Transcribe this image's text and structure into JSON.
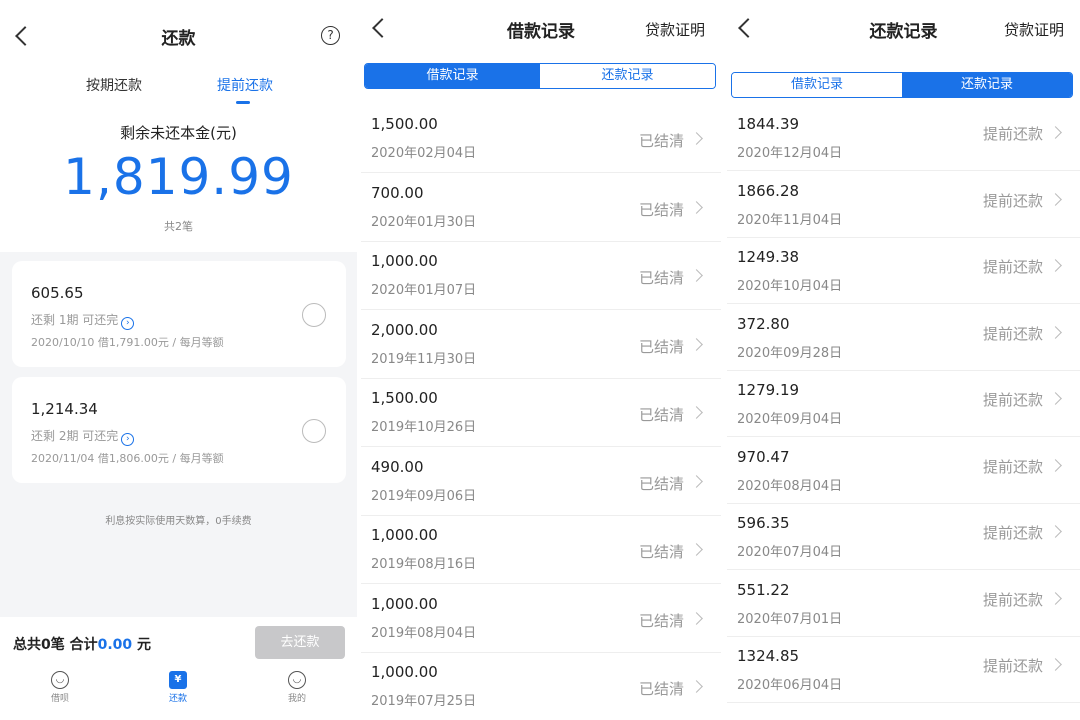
{
  "repay": {
    "title": "还款",
    "help_symbol": "?",
    "tabs": [
      "按期还款",
      "提前还款"
    ],
    "summary": {
      "label": "剩余未还本金(元)",
      "amount": "1,819.99",
      "count": "共2笔"
    },
    "bills": [
      {
        "amount": "605.65",
        "remain": "还剩 1期 可还完",
        "detail": "2020/10/10 借1,791.00元 / 每月等额"
      },
      {
        "amount": "1,214.34",
        "remain": "还剩 2期 可还完",
        "detail": "2020/11/04 借1,806.00元 / 每月等额"
      }
    ],
    "note": "利息按实际使用天数算，0手续费",
    "footer": {
      "total_prefix": "总共0笔 合计",
      "total_amount": "0.00",
      "total_suffix": " 元",
      "pay_button": "去还款"
    },
    "nav": [
      {
        "label": "借呗",
        "icon": "smile-face-icon",
        "glyph": "◡"
      },
      {
        "label": "还款",
        "icon": "yuan-icon",
        "glyph": "¥"
      },
      {
        "label": "我的",
        "icon": "profile-icon",
        "glyph": "◡"
      }
    ]
  },
  "loan_records": {
    "title": "借款记录",
    "certificate_link": "贷款证明",
    "segments": [
      "借款记录",
      "还款记录"
    ],
    "active_segment": 0,
    "rows": [
      {
        "amount": "1,500.00",
        "date": "2020年02月04日",
        "status": "已结清"
      },
      {
        "amount": "700.00",
        "date": "2020年01月30日",
        "status": "已结清"
      },
      {
        "amount": "1,000.00",
        "date": "2020年01月07日",
        "status": "已结清"
      },
      {
        "amount": "2,000.00",
        "date": "2019年11月30日",
        "status": "已结清"
      },
      {
        "amount": "1,500.00",
        "date": "2019年10月26日",
        "status": "已结清"
      },
      {
        "amount": "490.00",
        "date": "2019年09月06日",
        "status": "已结清"
      },
      {
        "amount": "1,000.00",
        "date": "2019年08月16日",
        "status": "已结清"
      },
      {
        "amount": "1,000.00",
        "date": "2019年08月04日",
        "status": "已结清"
      },
      {
        "amount": "1,000.00",
        "date": "2019年07月25日",
        "status": "已结清"
      }
    ]
  },
  "repay_records": {
    "title": "还款记录",
    "certificate_link": "贷款证明",
    "segments": [
      "借款记录",
      "还款记录"
    ],
    "active_segment": 1,
    "rows": [
      {
        "amount": "1844.39",
        "date": "2020年12月04日",
        "status": "提前还款"
      },
      {
        "amount": "1866.28",
        "date": "2020年11月04日",
        "status": "提前还款"
      },
      {
        "amount": "1249.38",
        "date": "2020年10月04日",
        "status": "提前还款"
      },
      {
        "amount": "372.80",
        "date": "2020年09月28日",
        "status": "提前还款"
      },
      {
        "amount": "1279.19",
        "date": "2020年09月04日",
        "status": "提前还款"
      },
      {
        "amount": "970.47",
        "date": "2020年08月04日",
        "status": "提前还款"
      },
      {
        "amount": "596.35",
        "date": "2020年07月04日",
        "status": "提前还款"
      },
      {
        "amount": "551.22",
        "date": "2020年07月01日",
        "status": "提前还款"
      },
      {
        "amount": "1324.85",
        "date": "2020年06月04日",
        "status": "提前还款"
      }
    ]
  },
  "colors": {
    "accent": "#1a72e8",
    "muted": "#999999",
    "disabled_button": "#c8c8ca"
  }
}
